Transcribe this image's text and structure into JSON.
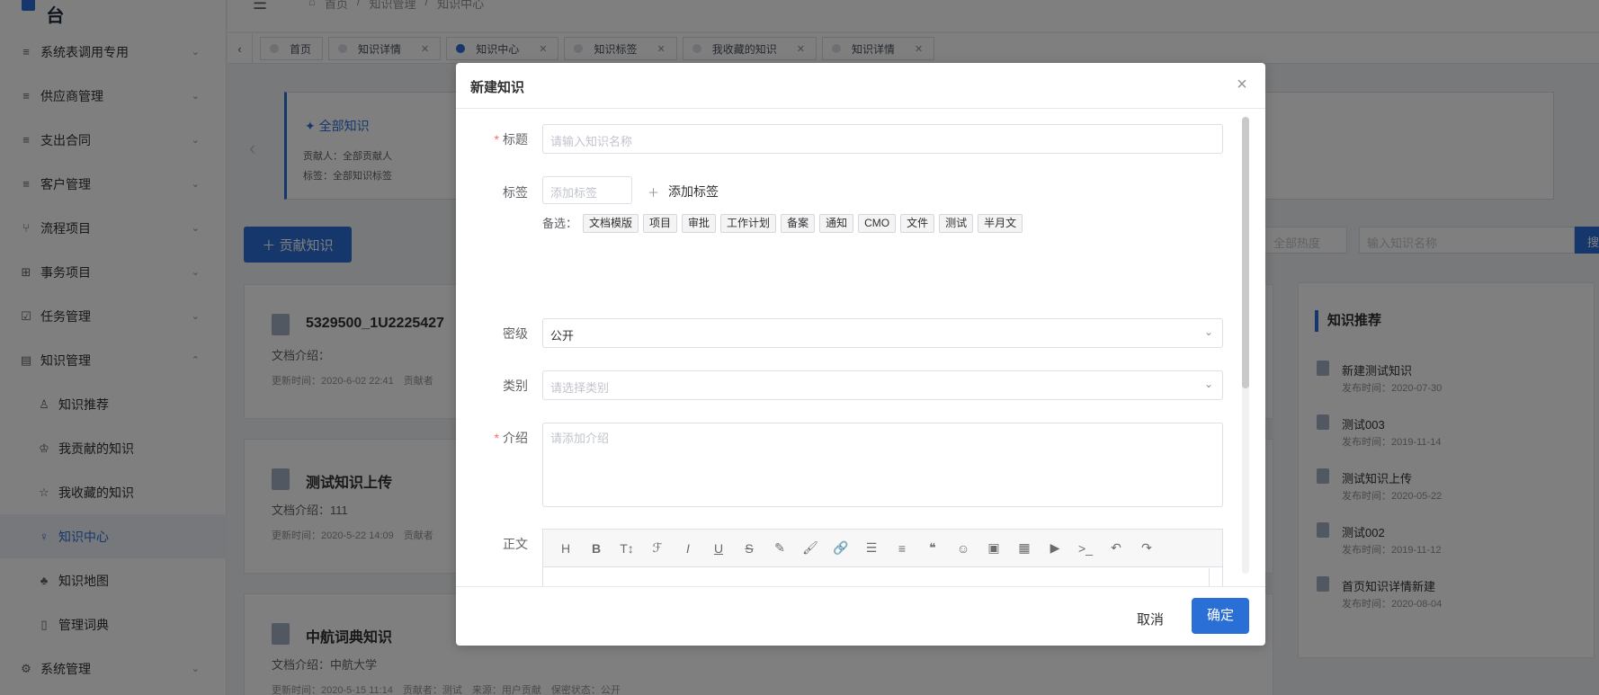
{
  "app": {
    "title": "TIME岗位知识赋能平台"
  },
  "sidebar": {
    "items": [
      {
        "label": "系统表调用专用",
        "icon": "menu-icon"
      },
      {
        "label": "供应商管理",
        "icon": "menu-icon"
      },
      {
        "label": "支出合同",
        "icon": "menu-icon"
      },
      {
        "label": "客户管理",
        "icon": "menu-icon"
      },
      {
        "label": "流程项目",
        "icon": "flow-icon"
      },
      {
        "label": "事务项目",
        "icon": "grid-icon"
      },
      {
        "label": "任务管理",
        "icon": "check-icon"
      },
      {
        "label": "知识管理",
        "icon": "book-icon"
      },
      {
        "label": "知识推荐",
        "icon": "thumb-icon"
      },
      {
        "label": "我贡献的知识",
        "icon": "trophy-icon"
      },
      {
        "label": "我收藏的知识",
        "icon": "star-icon"
      },
      {
        "label": "知识中心",
        "icon": "bulb-icon"
      },
      {
        "label": "知识地图",
        "icon": "map-icon"
      },
      {
        "label": "管理词典",
        "icon": "dict-icon"
      },
      {
        "label": "系统管理",
        "icon": "gear-icon"
      }
    ]
  },
  "breadcrumb": {
    "home": "首页",
    "section": "知识管理",
    "current": "知识中心"
  },
  "tabs": [
    "首页",
    "知识详情",
    "知识中心",
    "知识标签",
    "我收藏的知识",
    "知识详情"
  ],
  "main": {
    "category": {
      "title": "全部知识",
      "contributor": "贡献人：全部贡献人",
      "tags": "标签：全部知识标签"
    },
    "contribute_button": "贡献知识",
    "heat_select": "全部热度",
    "search_placeholder": "输入知识名称",
    "search_button": "搜",
    "docs": [
      {
        "title": "5329500_1U2225427",
        "intro": "文档介绍：",
        "meta": "更新时间：2020-6-02 22:41　贡献者"
      },
      {
        "title": "测试知识上传",
        "intro": "文档介绍：111",
        "meta": "更新时间：2020-5-22 14:09　贡献者"
      },
      {
        "title": "中航词典知识",
        "intro": "文档介绍：中航大学",
        "meta": "更新时间：2020-5-15 11:14　贡献者：测试　来源：用户贡献　保密状态：公开"
      }
    ],
    "recommend": {
      "title": "知识推荐",
      "items": [
        {
          "name": "新建测试知识",
          "date": "发布时间：2020-07-30"
        },
        {
          "name": "测试003",
          "date": "发布时间：2019-11-14"
        },
        {
          "name": "测试知识上传",
          "date": "发布时间：2020-05-22"
        },
        {
          "name": "测试002",
          "date": "发布时间：2019-11-12"
        },
        {
          "name": "首页知识详情新建",
          "date": "发布时间：2020-08-04"
        }
      ]
    }
  },
  "modal": {
    "title": "新建知识",
    "title_label": "标题",
    "title_placeholder": "请输入知识名称",
    "tags_label": "标签",
    "tags_placeholder": "添加标签",
    "add_tag": "添加标签",
    "candidates_label": "备选：",
    "candidates": [
      "文档模版",
      "项目",
      "审批",
      "工作计划",
      "备案",
      "通知",
      "CMO",
      "文件",
      "测试",
      "半月文"
    ],
    "secret_label": "密级",
    "secret_value": "公开",
    "category_label": "类别",
    "category_placeholder": "请选择类别",
    "intro_label": "介绍",
    "intro_placeholder": "请添加介绍",
    "body_label": "正文",
    "toolbar": [
      "heading-icon",
      "bold-icon",
      "font-size-icon",
      "font-family-icon",
      "italic-icon",
      "underline-icon",
      "strikethrough-icon",
      "highlight-icon",
      "brush-icon",
      "link-icon",
      "list-icon",
      "align-icon",
      "quote-icon",
      "emoji-icon",
      "image-icon",
      "table-icon",
      "video-icon",
      "code-icon",
      "undo-icon",
      "redo-icon"
    ],
    "cancel": "取消",
    "confirm": "确定"
  }
}
